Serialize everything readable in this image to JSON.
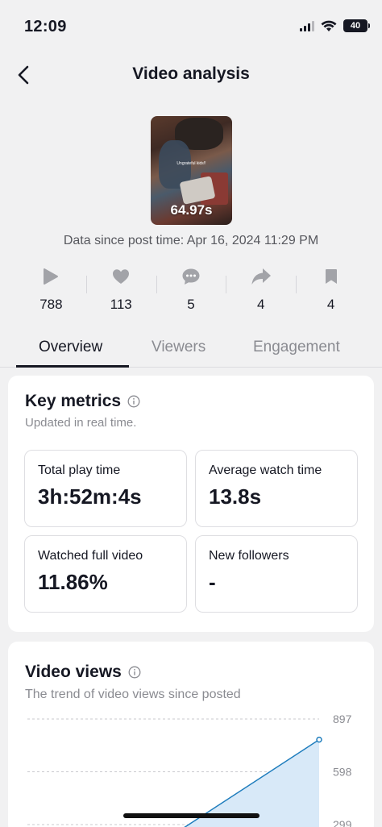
{
  "status_bar": {
    "time": "12:09",
    "battery": "40"
  },
  "nav": {
    "title": "Video analysis"
  },
  "video": {
    "duration": "64.97s",
    "caption": "Ungrateful kids!!"
  },
  "data_since": "Data since post time: Apr 16, 2024 11:29 PM",
  "stats": [
    {
      "icon": "play-icon",
      "value": "788"
    },
    {
      "icon": "heart-icon",
      "value": "113"
    },
    {
      "icon": "comment-icon",
      "value": "5"
    },
    {
      "icon": "share-icon",
      "value": "4"
    },
    {
      "icon": "bookmark-icon",
      "value": "4"
    }
  ],
  "tabs": [
    {
      "label": "Overview",
      "active": true
    },
    {
      "label": "Viewers",
      "active": false
    },
    {
      "label": "Engagement",
      "active": false
    }
  ],
  "key_metrics": {
    "title": "Key metrics",
    "subtitle": "Updated in real time.",
    "items": [
      {
        "label": "Total play time",
        "value": "3h:52m:4s"
      },
      {
        "label": "Average watch time",
        "value": "13.8s"
      },
      {
        "label": "Watched full video",
        "value": "11.86%"
      },
      {
        "label": "New followers",
        "value": "-"
      }
    ]
  },
  "video_views": {
    "title": "Video views",
    "subtitle": "The trend of video views since posted"
  },
  "colors": {
    "accent": "#1f7dbd",
    "fill": "#d8e9f8"
  },
  "chart_data": {
    "type": "area",
    "y_ticks": [
      897,
      598,
      299
    ],
    "points": [
      {
        "x": 0,
        "y": 120
      },
      {
        "x": 1,
        "y": 780
      }
    ],
    "ylim": [
      0,
      897
    ],
    "grid": true
  }
}
